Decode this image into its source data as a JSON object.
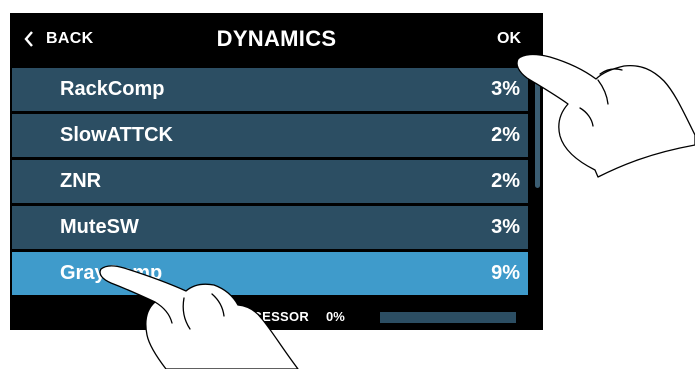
{
  "header": {
    "back_label": "BACK",
    "title": "DYNAMICS",
    "ok_label": "OK"
  },
  "effects": [
    {
      "name": "RackComp",
      "value": "3%",
      "selected": false
    },
    {
      "name": "SlowATTCK",
      "value": "2%",
      "selected": false
    },
    {
      "name": "ZNR",
      "value": "2%",
      "selected": false
    },
    {
      "name": "MuteSW",
      "value": "3%",
      "selected": false
    },
    {
      "name": "GrayComp",
      "value": "9%",
      "selected": true
    }
  ],
  "footer": {
    "processor_label": "OCESSOR",
    "processor_value": "0%",
    "processor_level": 0
  },
  "colors": {
    "row": "#2c4e63",
    "selected_row": "#3f9bcb",
    "screen_bg": "#000000"
  },
  "icons": {
    "back": "chevron-left-icon",
    "gesture": "pointing-hand-icon"
  }
}
